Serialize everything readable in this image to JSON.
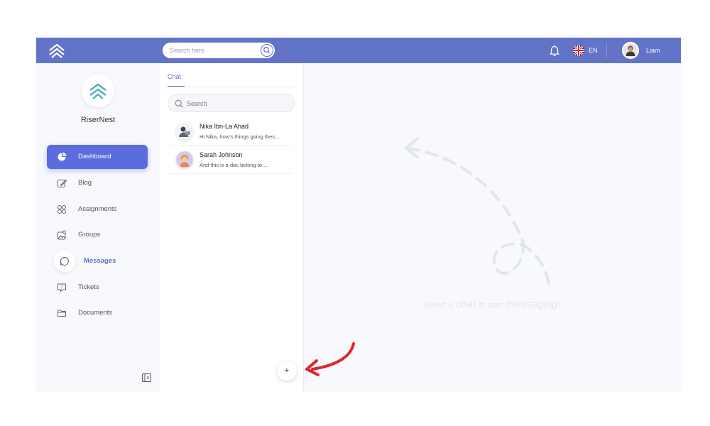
{
  "topbar": {
    "search": {
      "placeholder": "Search here"
    },
    "language": "EN",
    "user": {
      "name": "Liam"
    },
    "colors": {
      "bar": "#6274c8"
    },
    "icons": [
      "logo-icon",
      "search-icon",
      "bell-icon",
      "uk-flag-icon",
      "avatar"
    ]
  },
  "sidebar": {
    "brand": "RiserNest",
    "items": [
      {
        "label": "Dashboard",
        "icon": "pie-chart-icon",
        "state": "active"
      },
      {
        "label": "Blog",
        "icon": "edit-icon"
      },
      {
        "label": "Assignments",
        "icon": "shapes-icon"
      },
      {
        "label": "Groups",
        "icon": "image-group-icon"
      },
      {
        "label": "Messages",
        "icon": "message-bubble-icon",
        "state": "selected"
      },
      {
        "label": "Tickets",
        "icon": "help-chat-icon"
      },
      {
        "label": "Documents",
        "icon": "folder-icon"
      }
    ],
    "collapse_icon": "collapse-sidebar-icon",
    "colors": {
      "active": "#5b6cde",
      "selected_text": "#6274c8"
    }
  },
  "chat": {
    "tab": "Chat",
    "search": {
      "placeholder": "Search"
    },
    "contacts": [
      {
        "name": "Nika Ibn-La Ahad",
        "preview": "Hi Nika, how's things going thes..."
      },
      {
        "name": "Sarah Johnson",
        "preview": "And this is a doc belong to ..."
      }
    ],
    "add_button": "+"
  },
  "main": {
    "empty_state": {
      "part1": "Select a",
      "part2": "chat",
      "part3": "to start",
      "part4": "messaging!"
    }
  },
  "annotation": {
    "color": "#e0242b",
    "icon": "curved-arrow-icon"
  }
}
